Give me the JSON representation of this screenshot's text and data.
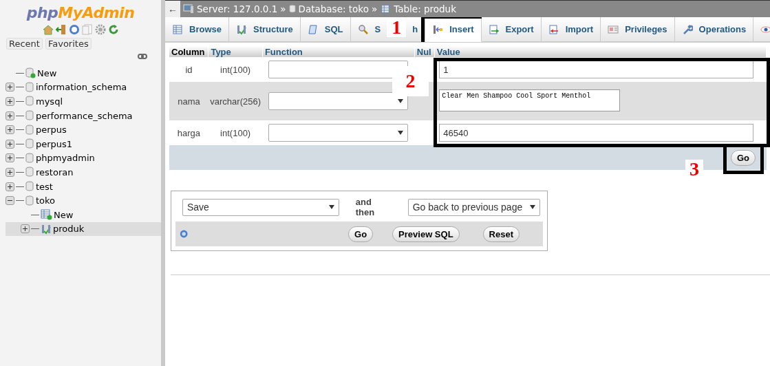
{
  "sidebar": {
    "logo": {
      "part1": "php",
      "part2": "MyAdmin"
    },
    "buttons": [
      "Recent",
      "Favorites"
    ],
    "tree": [
      {
        "label": "New",
        "kind": "new",
        "selected": false
      },
      {
        "label": "information_schema",
        "kind": "db",
        "expanded": false,
        "selected": false
      },
      {
        "label": "mysql",
        "kind": "db",
        "expanded": false,
        "selected": false
      },
      {
        "label": "performance_schema",
        "kind": "db",
        "expanded": false,
        "selected": false
      },
      {
        "label": "perpus",
        "kind": "db",
        "expanded": false,
        "selected": false
      },
      {
        "label": "perpus1",
        "kind": "db",
        "expanded": false,
        "selected": false
      },
      {
        "label": "phpmyadmin",
        "kind": "db",
        "expanded": false,
        "selected": false
      },
      {
        "label": "restoran",
        "kind": "db",
        "expanded": false,
        "selected": false
      },
      {
        "label": "test",
        "kind": "db",
        "expanded": false,
        "selected": false
      },
      {
        "label": "toko",
        "kind": "db",
        "expanded": true,
        "selected": false,
        "children": [
          {
            "label": "New",
            "kind": "new_table",
            "selected": false
          },
          {
            "label": "produk",
            "kind": "table",
            "expanded": false,
            "selected": true
          }
        ]
      }
    ]
  },
  "breadcrumb": {
    "back": "←",
    "items": [
      {
        "label": "Server: 127.0.0.1",
        "kind": "server"
      },
      {
        "label": "Database: toko",
        "kind": "database"
      },
      {
        "label": "Table: produk",
        "kind": "table"
      }
    ],
    "separator": "»"
  },
  "tabs": [
    {
      "label": "Browse",
      "selected": false
    },
    {
      "label": "Structure",
      "selected": false
    },
    {
      "label": "SQL",
      "selected": false
    },
    {
      "label_start": "S",
      "label_end": "h",
      "selected": false
    },
    {
      "label": "Insert",
      "selected": true
    },
    {
      "label": "Export",
      "selected": false
    },
    {
      "label": "Import",
      "selected": false
    },
    {
      "label": "Privileges",
      "selected": false
    },
    {
      "label": "Operations",
      "selected": false
    },
    {
      "selected": false
    }
  ],
  "form": {
    "columns": [
      "Column",
      "Type",
      "Function",
      "Nul",
      "Value"
    ],
    "rows": [
      {
        "column": "id",
        "type": "int(100)",
        "kind": "input",
        "value": "1"
      },
      {
        "column": "nama",
        "type": "varchar(256)",
        "kind": "textarea",
        "value": "Clear Men Shampoo Cool Sport Menthol"
      },
      {
        "column": "harga",
        "type": "int(100)",
        "kind": "input",
        "value": "46540"
      }
    ],
    "go": "Go"
  },
  "actions": {
    "action": "Save",
    "and_then": "and then",
    "after": "Go back to previous page",
    "buttons": [
      "Go",
      "Preview SQL",
      "Reset"
    ]
  },
  "annotations": [
    {
      "label": "1"
    },
    {
      "label": "2"
    },
    {
      "label": "3"
    }
  ]
}
